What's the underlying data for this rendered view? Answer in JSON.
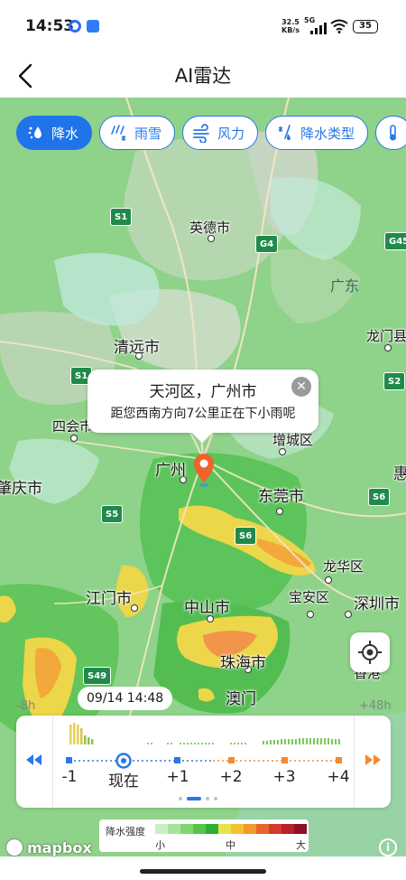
{
  "status_bar": {
    "time": "14:53",
    "speed_value": "32.5",
    "speed_unit": "KB/s",
    "network": "5G",
    "battery": "35"
  },
  "nav": {
    "title": "AI雷达",
    "back_icon": "chevron-left-icon"
  },
  "layers": [
    {
      "label": "降水",
      "icon": "rain-drop-icon",
      "active": true
    },
    {
      "label": "雨雪",
      "icon": "snow-rain-icon",
      "active": false
    },
    {
      "label": "风力",
      "icon": "wind-icon",
      "active": false
    },
    {
      "label": "降水类型",
      "icon": "precip-type-icon",
      "active": false
    }
  ],
  "map": {
    "cities": {
      "yingde": "英德市",
      "qingyuan": "清远市",
      "sihui": "四会市",
      "zhaoqing": "肇庆市",
      "guangzhou": "广州",
      "zengcheng": "增城区",
      "dongguan": "东莞市",
      "jiangmen": "江门市",
      "zhongshan": "中山市",
      "baoan": "宝安区",
      "longhua": "龙华区",
      "shenzhen": "深圳市",
      "zhuhai": "珠海市",
      "aomen": "澳门",
      "xianggang": "香港",
      "longmen": "龙门县",
      "hui": "惠",
      "guangdong": "广东"
    },
    "roads": [
      "S1",
      "G4",
      "G45",
      "S2",
      "S5",
      "S6",
      "S6",
      "S49"
    ]
  },
  "popup": {
    "title": "天河区，广州市",
    "message": "距您西南方向7公里正在下小雨呢"
  },
  "timeline": {
    "current_time": "09/14 14:48",
    "start_offset": "-8h",
    "end_offset": "+48h",
    "ticks": [
      "-1",
      "现在",
      "+1",
      "+2",
      "+3",
      "+4"
    ]
  },
  "legend": {
    "title": "降水强度",
    "low": "小",
    "mid": "中",
    "high": "大",
    "colors": [
      "#c8f0c8",
      "#a4e59a",
      "#7fd670",
      "#55c44a",
      "#2fae36",
      "#e8e34a",
      "#f2c233",
      "#f29a2e",
      "#e8662a",
      "#d63a2a",
      "#b8202a",
      "#8e0f2a"
    ]
  },
  "attribution": "mapbox"
}
